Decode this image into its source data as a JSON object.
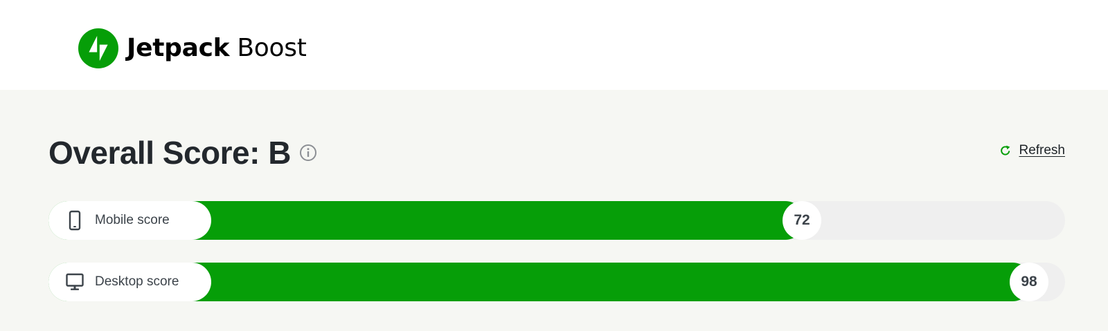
{
  "brand": {
    "name_bold": "Jetpack",
    "name_regular": " Boost",
    "logo_color": "#069e08",
    "logo_icon": "jetpack-bolt-icon"
  },
  "score": {
    "title": "Overall Score: B",
    "info_icon": "info-icon"
  },
  "refresh": {
    "label": "Refresh",
    "icon": "refresh-icon",
    "icon_color": "#069e08"
  },
  "bars": [
    {
      "label": "Mobile score",
      "icon": "mobile-phone-icon",
      "value": "72",
      "fill_color": "#069e08"
    },
    {
      "label": "Desktop score",
      "icon": "desktop-monitor-icon",
      "value": "98",
      "fill_color": "#069e08"
    }
  ]
}
